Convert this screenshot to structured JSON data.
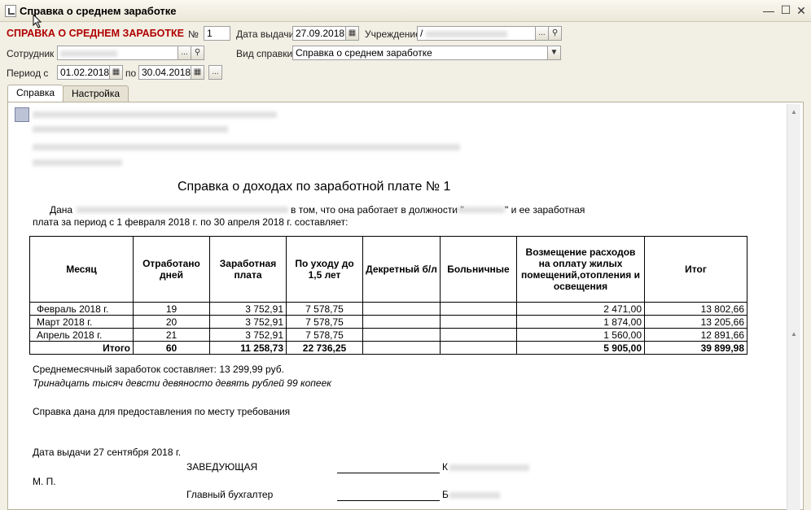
{
  "window": {
    "title": "Справка о среднем заработке"
  },
  "header": {
    "title": "СПРАВКА О СРЕДНЕМ ЗАРАБОТКЕ",
    "number_label": "№",
    "number_value": "1",
    "issue_date_label": "Дата выдачи",
    "issue_date_value": "27.09.2018",
    "institution_label": "Учреждение",
    "institution_value": "/",
    "employee_label": "Сотрудник",
    "employee_value": "",
    "type_label": "Вид справки",
    "type_value": "Справка о среднем заработке",
    "period_from_label": "Период с",
    "period_from_value": "01.02.2018",
    "period_to_label": "по",
    "period_to_value": "30.04.2018",
    "more_button": "..."
  },
  "tabs": [
    "Справка",
    "Настройка"
  ],
  "document": {
    "title": "Справка о доходах по заработной плате № 1",
    "line1_a": "Дана",
    "line1_b": "в том, что она работает в должности \"",
    "line1_c": "\" и ее заработная",
    "line2": "плата за период с 1 февраля 2018 г. по 30 апреля 2018 г. составляет:",
    "table": {
      "headers": [
        "Месяц",
        "Отработано дней",
        "Заработная плата",
        "По уходу до 1,5 лет",
        "Декретный б/л",
        "Больничные",
        "Возмещение расходов на оплату жилых помещений,отопления и освещения",
        "Итог"
      ],
      "rows": [
        [
          "Февраль 2018 г.",
          "19",
          "3 752,91",
          "7 578,75",
          "",
          "",
          "2 471,00",
          "13 802,66"
        ],
        [
          "Март 2018 г.",
          "20",
          "3 752,91",
          "7 578,75",
          "",
          "",
          "1 874,00",
          "13 205,66"
        ],
        [
          "Апрель 2018 г.",
          "21",
          "3 752,91",
          "7 578,75",
          "",
          "",
          "1 560,00",
          "12 891,66"
        ]
      ],
      "total": [
        "Итого",
        "60",
        "11 258,73",
        "22 736,25",
        "",
        "",
        "5 905,00",
        "39 899,98"
      ]
    },
    "avg_text": "Среднемесячный заработок составляет: 13 299,99 руб.",
    "avg_words": "Тринадцать тысяч девсти девяносто девять рублей 99 копеек",
    "purpose": "Справка дана для предоставления по месту требования",
    "issue_date_text": "Дата выдачи 27 сентября 2018 г.",
    "head_position": "ЗАВЕДУЮЩАЯ",
    "head_initial": "К",
    "stamp": "М. П.",
    "accountant_position": "Главный бухгалтер",
    "accountant_initial": "Б"
  }
}
